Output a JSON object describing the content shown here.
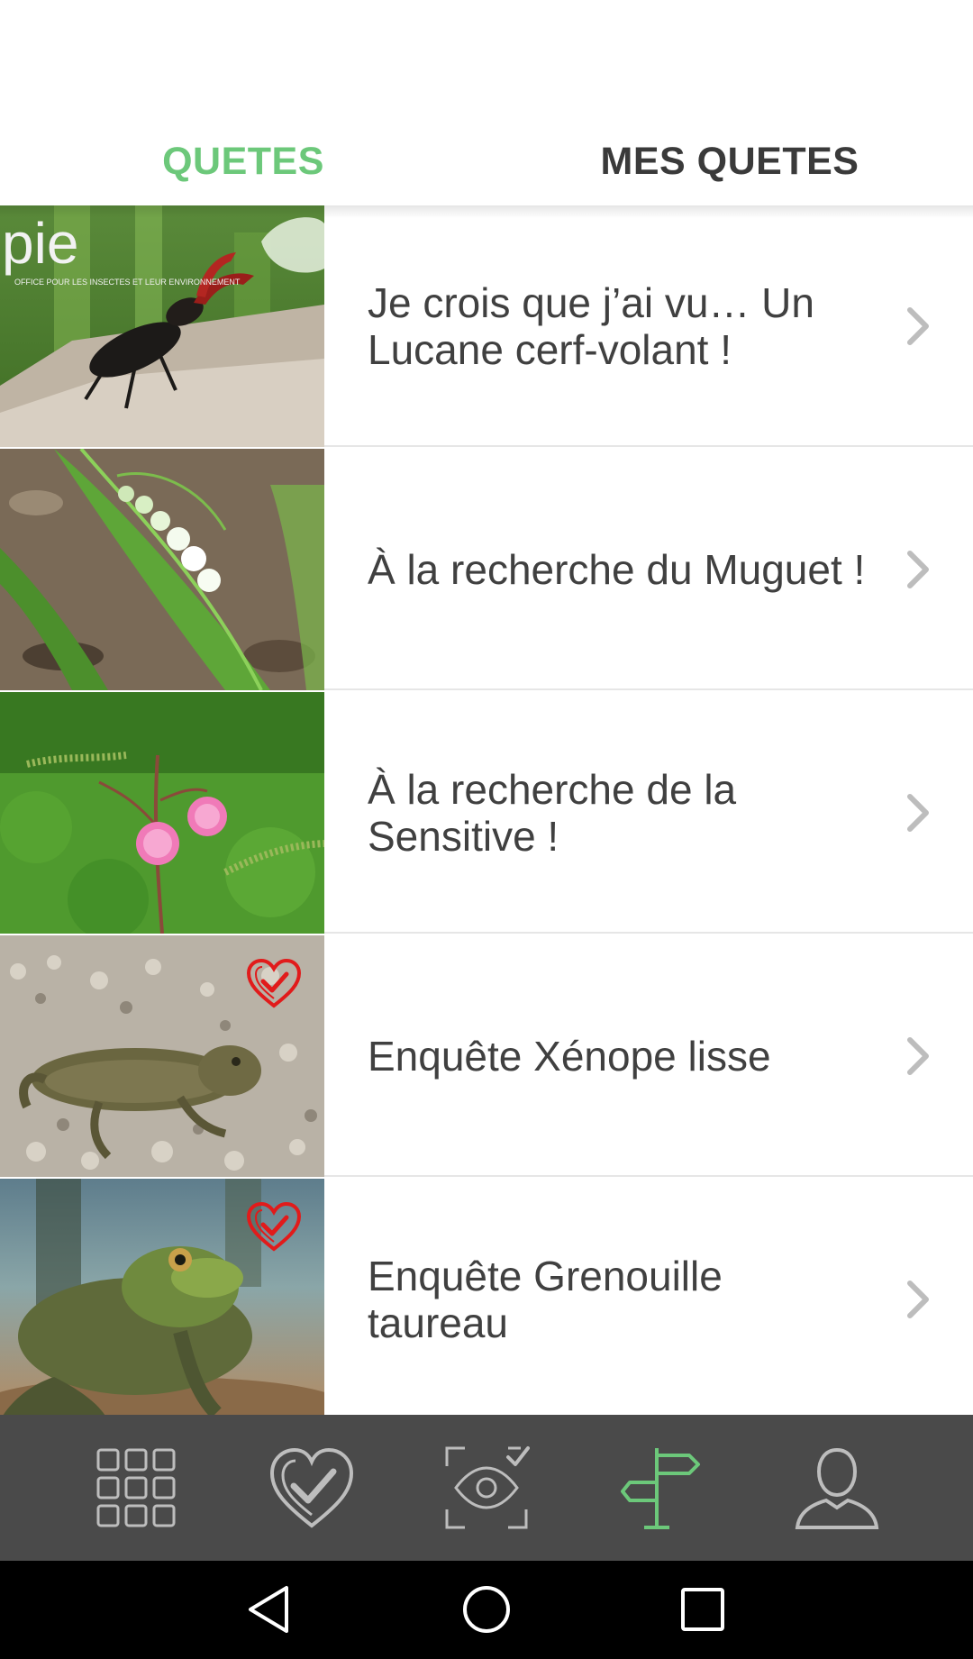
{
  "tabs": [
    {
      "label": "QUETES",
      "active": true
    },
    {
      "label": "MES QUETES",
      "active": false
    }
  ],
  "colors": {
    "accent": "#6cc87a",
    "tab_inactive": "#3a3a3a",
    "nav_bg": "#4a4a4a",
    "nav_icon": "#bdbdbd",
    "favorite_badge": "#e11b1b"
  },
  "quests": [
    {
      "title": "Je crois que j’ai vu… Un Lucane cerf-volant !",
      "image": "stag-beetle-photo",
      "thumb_text": "pie",
      "thumb_caption": "OFFICE POUR LES INSECTES ET LEUR ENVIRONNEMENT",
      "favorite": false
    },
    {
      "title": "À la recherche du Muguet !",
      "image": "lily-of-the-valley-photo",
      "favorite": false
    },
    {
      "title": "À la recherche de la Sensitive !",
      "image": "mimosa-pudica-photo",
      "favorite": false
    },
    {
      "title": "Enquête Xénope lisse",
      "image": "african-clawed-frog-photo",
      "favorite": true
    },
    {
      "title": "Enquête Grenouille taureau",
      "image": "bullfrog-photo",
      "favorite": true
    }
  ],
  "bottom_nav": [
    {
      "icon": "grid-icon",
      "active": false
    },
    {
      "icon": "heart-check-icon",
      "active": false
    },
    {
      "icon": "eye-scan-icon",
      "active": false
    },
    {
      "icon": "signpost-icon",
      "active": true
    },
    {
      "icon": "user-icon",
      "active": false
    }
  ],
  "system_nav": [
    "back-triangle-icon",
    "home-circle-icon",
    "recents-square-icon"
  ]
}
